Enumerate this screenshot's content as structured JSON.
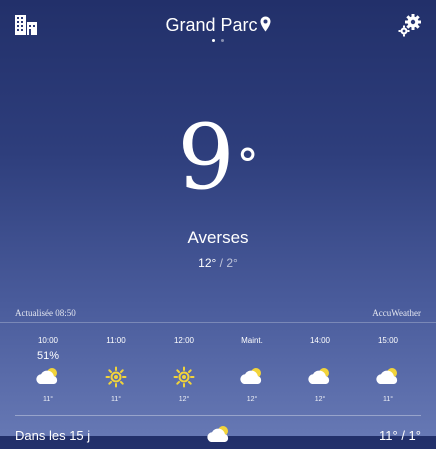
{
  "header": {
    "location": "Grand Parc",
    "icons": {
      "left": "city-list-icon",
      "right": "settings-gears-icon",
      "pin": "location-pin-icon"
    },
    "page_indicator": {
      "count": 2,
      "active": 0
    }
  },
  "current": {
    "temperature": "9",
    "degree_symbol": "°",
    "condition": "Averses",
    "high": "12°",
    "separator": " / ",
    "low": "2°"
  },
  "meta": {
    "updated": "Actualisée 08:50",
    "provider": "AccuWeather"
  },
  "hourly": [
    {
      "time": "10:00",
      "precip": "51%",
      "icon": "cloud-sun-icon",
      "temp": "11°"
    },
    {
      "time": "11:00",
      "precip": "",
      "icon": "sun-icon",
      "temp": "11°"
    },
    {
      "time": "12:00",
      "precip": "",
      "icon": "sun-icon",
      "temp": "12°"
    },
    {
      "time": "Maint.",
      "precip": "",
      "icon": "cloud-sun-icon",
      "temp": "12°"
    },
    {
      "time": "14:00",
      "precip": "",
      "icon": "cloud-sun-icon",
      "temp": "12°"
    },
    {
      "time": "15:00",
      "precip": "",
      "icon": "cloud-sun-icon",
      "temp": "11°"
    }
  ],
  "forecast": {
    "label": "Dans les 15 j",
    "icon": "cloud-sun-icon",
    "range": "11° / 1°"
  },
  "colors": {
    "background_top": "#22306a",
    "background_bottom": "#6678b4",
    "sun": "#f2d43a"
  }
}
